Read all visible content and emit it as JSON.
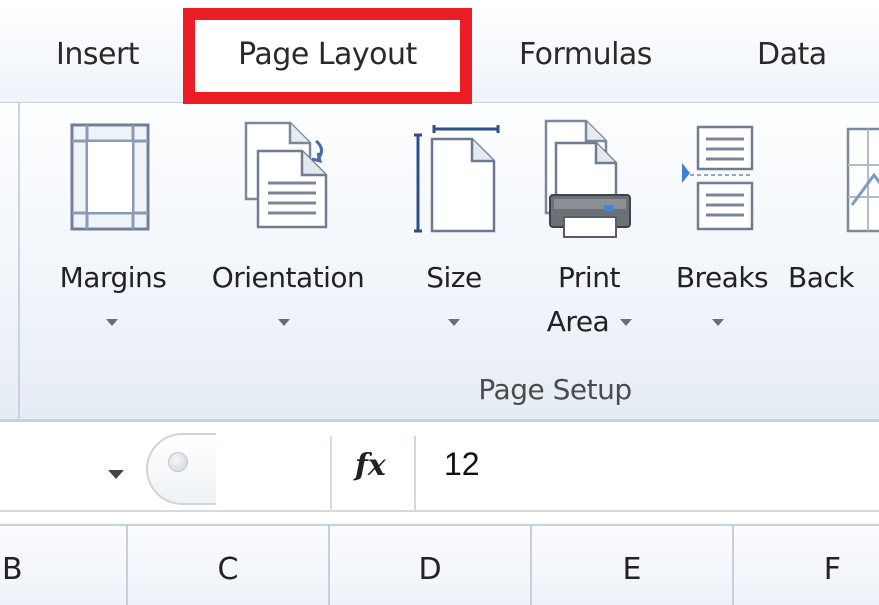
{
  "tabs": {
    "insert": "Insert",
    "page_layout": "Page Layout",
    "formulas": "Formulas",
    "data": "Data"
  },
  "highlight_color": "#ec1c24",
  "ribbon": {
    "margins": "Margins",
    "orientation": "Orientation",
    "size": "Size",
    "print_area_line1": "Print",
    "print_area_line2": "Area",
    "breaks": "Breaks",
    "background_partial": "Back",
    "group_label": "Page Setup"
  },
  "formula_bar": {
    "fx": "fx",
    "value": "12"
  },
  "columns": [
    "B",
    "C",
    "D",
    "E",
    "F"
  ]
}
